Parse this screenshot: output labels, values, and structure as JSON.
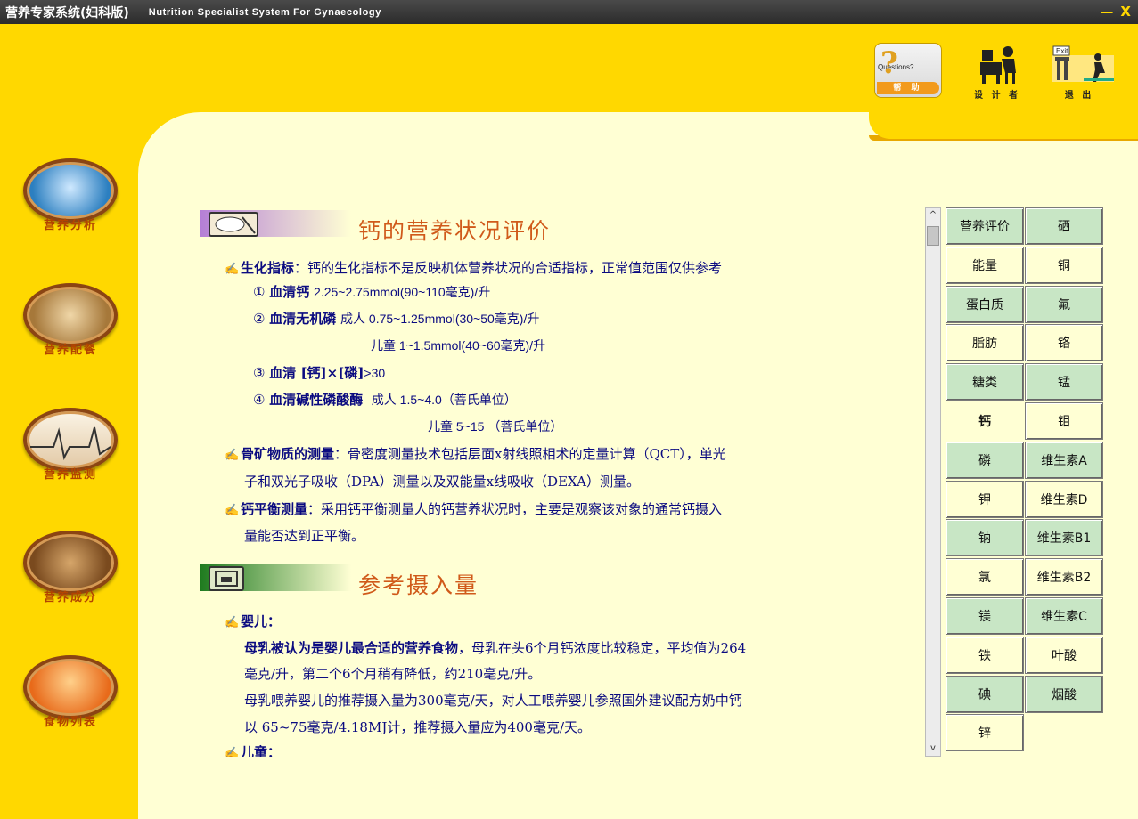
{
  "window": {
    "title": "营养专家系统(妇科版)",
    "subtitle": "Nutrition  Specialist  System  For  Gynaecology",
    "minimize": "—",
    "close": "X"
  },
  "topbar": {
    "help_question": "?",
    "help_text": "Questions?",
    "help_label": "帮 助",
    "designer_label": "设 计 者",
    "exit_label": "退 出",
    "exit_sign": "Exit"
  },
  "sidebar": {
    "items": [
      {
        "label": "营养分析"
      },
      {
        "label": "营养配餐"
      },
      {
        "label": "营养监测"
      },
      {
        "label": "营养成分"
      },
      {
        "label": "食物列表"
      }
    ]
  },
  "section1": {
    "title": "钙的营养状况评价",
    "lines": {
      "l1_bold": "生化指标",
      "l1_text": "：钙的生化指标不是反映机体营养状况的合适指标，正常值范围仅供参考",
      "l2_num": "①",
      "l2_bold": "血清钙",
      "l2_text": "2.25~2.75mmol(90~110毫克)/升",
      "l3_num": "②",
      "l3_bold": "血清无机磷",
      "l3_text": "成人 0.75~1.25mmol(30~50毫克)/升",
      "l4_text": "儿童 1~1.5mmol(40~60毫克)/升",
      "l5_num": "③",
      "l5_bold": "血清 [钙]×[磷]",
      "l5_text": ">30",
      "l6_num": "④",
      "l6_bold": "血清碱性磷酸酶",
      "l6_text": "成人 1.5~4.0（菩氏单位）",
      "l7_text": "儿童 5~15      （菩氏单位）",
      "l8_bold": "骨矿物质的测量",
      "l8_text": "：骨密度测量技术包括层面x射线照相术的定量计算（QCT），单光",
      "l9_text": "子和双光子吸收（DPA）测量以及双能量x线吸收（DEXA）测量。",
      "l10_bold": "钙平衡测量",
      "l10_text": "：采用钙平衡测量人的钙营养状况时，主要是观察该对象的通常钙摄入",
      "l11_text": "量能否达到正平衡。"
    }
  },
  "section2": {
    "title": "参考摄入量",
    "lines": {
      "m1_bold": "婴儿：",
      "m2_bold": "母乳被认为是婴儿最合适的营养食物",
      "m2_text": "，母乳在头6个月钙浓度比较稳定，平均值为264",
      "m3_text": "毫克/升，第二个6个月稍有降低，约210毫克/升。",
      "m4_text": "母乳喂养婴儿的推荐摄入量为300毫克/天，对人工喂养婴儿参照国外建议配方奶中钙",
      "m5_text": "以 65~75毫克/4.18MJ计，推荐摄入量应为400毫克/天。",
      "m6_bold": "儿童："
    }
  },
  "scrollbar": {
    "up": "^",
    "down": "v"
  },
  "nutrients": {
    "left": [
      "营养评价",
      "能量",
      "蛋白质",
      "脂肪",
      "糖类",
      "钙",
      "磷",
      "钾",
      "钠",
      "氯",
      "镁",
      "铁",
      "碘",
      "锌"
    ],
    "right": [
      "硒",
      "铜",
      "氟",
      "铬",
      "锰",
      "钼",
      "维生素A",
      "维生素D",
      "维生素B1",
      "维生素B2",
      "维生素C",
      "叶酸",
      "烟酸"
    ],
    "active": "钙"
  }
}
